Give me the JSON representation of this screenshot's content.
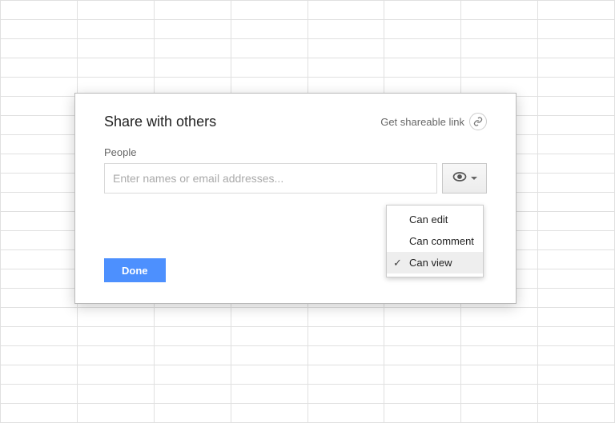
{
  "dialog": {
    "title": "Share with others",
    "shareable_link_label": "Get shareable link",
    "people_label": "People",
    "people_placeholder": "Enter names or email addresses...",
    "done_label": "Done"
  },
  "permission_menu": {
    "options": [
      {
        "label": "Can edit"
      },
      {
        "label": "Can comment"
      },
      {
        "label": "Can view"
      }
    ],
    "selected_index": 2,
    "button_icon": "eye-icon"
  }
}
